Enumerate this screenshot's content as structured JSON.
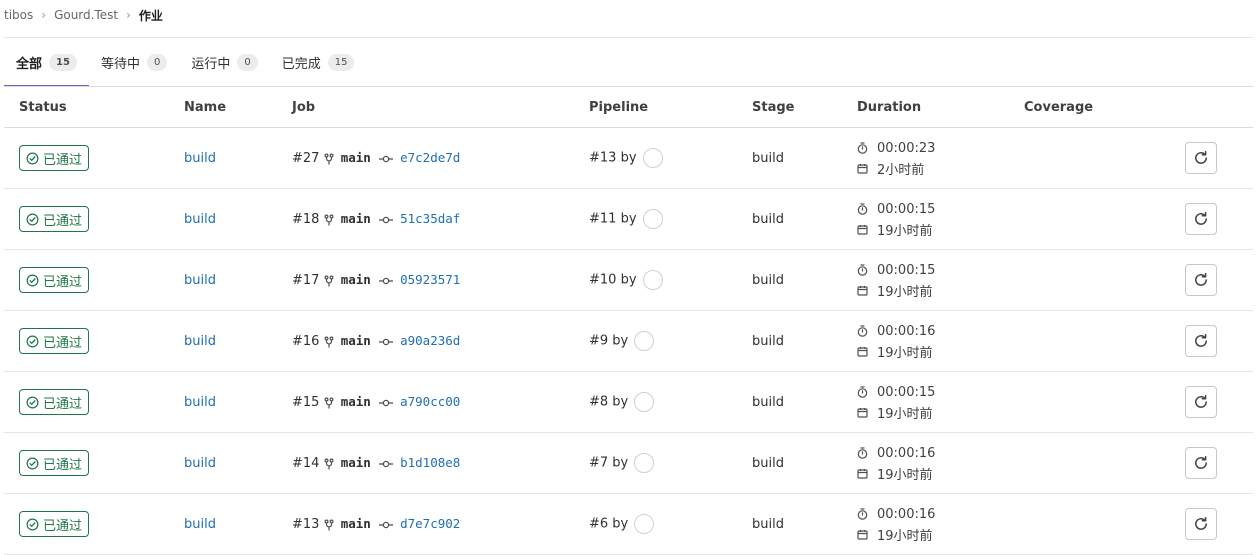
{
  "breadcrumb": {
    "items": [
      "tibos",
      "Gourd.Test"
    ],
    "current": "作业"
  },
  "tabs": [
    {
      "label": "全部",
      "count": "15"
    },
    {
      "label": "等待中",
      "count": "0"
    },
    {
      "label": "运行中",
      "count": "0"
    },
    {
      "label": "已完成",
      "count": "15"
    }
  ],
  "columns": {
    "status": "Status",
    "name": "Name",
    "job": "Job",
    "pipeline": "Pipeline",
    "stage": "Stage",
    "duration": "Duration",
    "coverage": "Coverage"
  },
  "colors": {
    "passed": "#217645",
    "link": "#1f6fb2",
    "tab_active": "#6b63c4"
  },
  "icons": {
    "status": "check-circle-icon",
    "branch": "branch-icon",
    "commit": "commit-icon",
    "timer": "timer-icon",
    "calendar": "calendar-icon",
    "retry": "retry-icon",
    "separator": "chevron-right-icon"
  },
  "rows": [
    {
      "status": "已通过",
      "name": "build",
      "job_id": "#27",
      "branch": "main",
      "sha": "e7c2de7d",
      "pipeline": "#13 by",
      "stage": "build",
      "duration": "00:00:23",
      "finished": "2小时前",
      "coverage": ""
    },
    {
      "status": "已通过",
      "name": "build",
      "job_id": "#18",
      "branch": "main",
      "sha": "51c35daf",
      "pipeline": "#11 by",
      "stage": "build",
      "duration": "00:00:15",
      "finished": "19小时前",
      "coverage": ""
    },
    {
      "status": "已通过",
      "name": "build",
      "job_id": "#17",
      "branch": "main",
      "sha": "05923571",
      "pipeline": "#10 by",
      "stage": "build",
      "duration": "00:00:15",
      "finished": "19小时前",
      "coverage": ""
    },
    {
      "status": "已通过",
      "name": "build",
      "job_id": "#16",
      "branch": "main",
      "sha": "a90a236d",
      "pipeline": "#9 by",
      "stage": "build",
      "duration": "00:00:16",
      "finished": "19小时前",
      "coverage": ""
    },
    {
      "status": "已通过",
      "name": "build",
      "job_id": "#15",
      "branch": "main",
      "sha": "a790cc00",
      "pipeline": "#8 by",
      "stage": "build",
      "duration": "00:00:15",
      "finished": "19小时前",
      "coverage": ""
    },
    {
      "status": "已通过",
      "name": "build",
      "job_id": "#14",
      "branch": "main",
      "sha": "b1d108e8",
      "pipeline": "#7 by",
      "stage": "build",
      "duration": "00:00:16",
      "finished": "19小时前",
      "coverage": ""
    },
    {
      "status": "已通过",
      "name": "build",
      "job_id": "#13",
      "branch": "main",
      "sha": "d7e7c902",
      "pipeline": "#6 by",
      "stage": "build",
      "duration": "00:00:16",
      "finished": "19小时前",
      "coverage": ""
    }
  ]
}
